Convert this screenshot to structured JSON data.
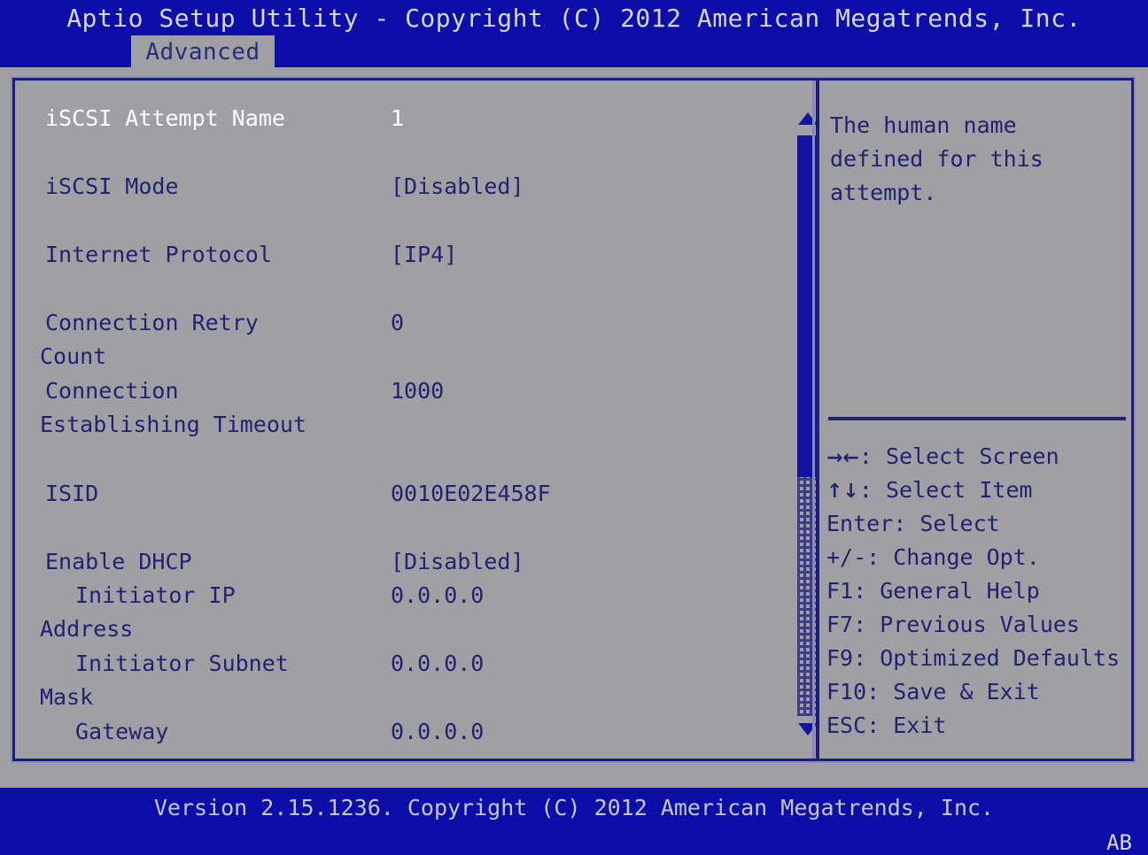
{
  "header": {
    "title": "Aptio Setup Utility - Copyright (C) 2012 American Megatrends, Inc.",
    "active_tab": "Advanced"
  },
  "colors": {
    "blue_background": "#0d0daa",
    "gray_panel": "#a0a0a4",
    "border_blue": "#1c1c7e",
    "text_blue": "#222270",
    "text_selected": "#ffffff",
    "scrollbar_blue": "#1414a0"
  },
  "settings": {
    "rows": [
      {
        "label": "iSCSI Attempt Name",
        "value": "1",
        "selected": true,
        "indent": false,
        "continuation": ""
      },
      {
        "label": "iSCSI Mode",
        "value": "[Disabled]",
        "selected": false,
        "indent": false,
        "continuation": ""
      },
      {
        "label": "Internet Protocol",
        "value": "[IP4]",
        "selected": false,
        "indent": false,
        "continuation": ""
      },
      {
        "label": "Connection Retry",
        "value": "0",
        "selected": false,
        "indent": false,
        "continuation": "Count"
      },
      {
        "label": "Connection",
        "value": "1000",
        "selected": false,
        "indent": false,
        "continuation": "Establishing Timeout"
      },
      {
        "label": "ISID",
        "value": "0010E02E458F",
        "selected": false,
        "indent": false,
        "continuation": ""
      },
      {
        "label": "Enable DHCP",
        "value": "[Disabled]",
        "selected": false,
        "indent": false,
        "continuation": ""
      },
      {
        "label": "Initiator IP",
        "value": "0.0.0.0",
        "selected": false,
        "indent": true,
        "continuation": "Address"
      },
      {
        "label": "Initiator Subnet",
        "value": "0.0.0.0",
        "selected": false,
        "indent": true,
        "continuation": "Mask"
      },
      {
        "label": "Gateway",
        "value": "0.0.0.0",
        "selected": false,
        "indent": true,
        "continuation": ""
      }
    ]
  },
  "scrollbar": {
    "up_arrow": "scroll-up-arrow",
    "down_arrow": "scroll-down-arrow",
    "thumb_position_percent": 0,
    "thumb_size_percent": 59
  },
  "help": {
    "description": "The human name\ndefined for this\nattempt.",
    "keys": [
      {
        "glyph": "→←",
        "text": ": Select Screen"
      },
      {
        "glyph": "↑↓",
        "text": ": Select Item"
      },
      {
        "glyph": "",
        "text": "Enter: Select"
      },
      {
        "glyph": "",
        "text": "+/-: Change Opt."
      },
      {
        "glyph": "",
        "text": "F1: General Help"
      },
      {
        "glyph": "",
        "text": "F7: Previous Values"
      },
      {
        "glyph": "",
        "text": "F9: Optimized Defaults"
      },
      {
        "glyph": "",
        "text": "F10: Save & Exit"
      },
      {
        "glyph": "",
        "text": "ESC: Exit"
      }
    ]
  },
  "footer": {
    "version": "Version 2.15.1236. Copyright (C) 2012 American Megatrends, Inc.",
    "code": "AB"
  }
}
